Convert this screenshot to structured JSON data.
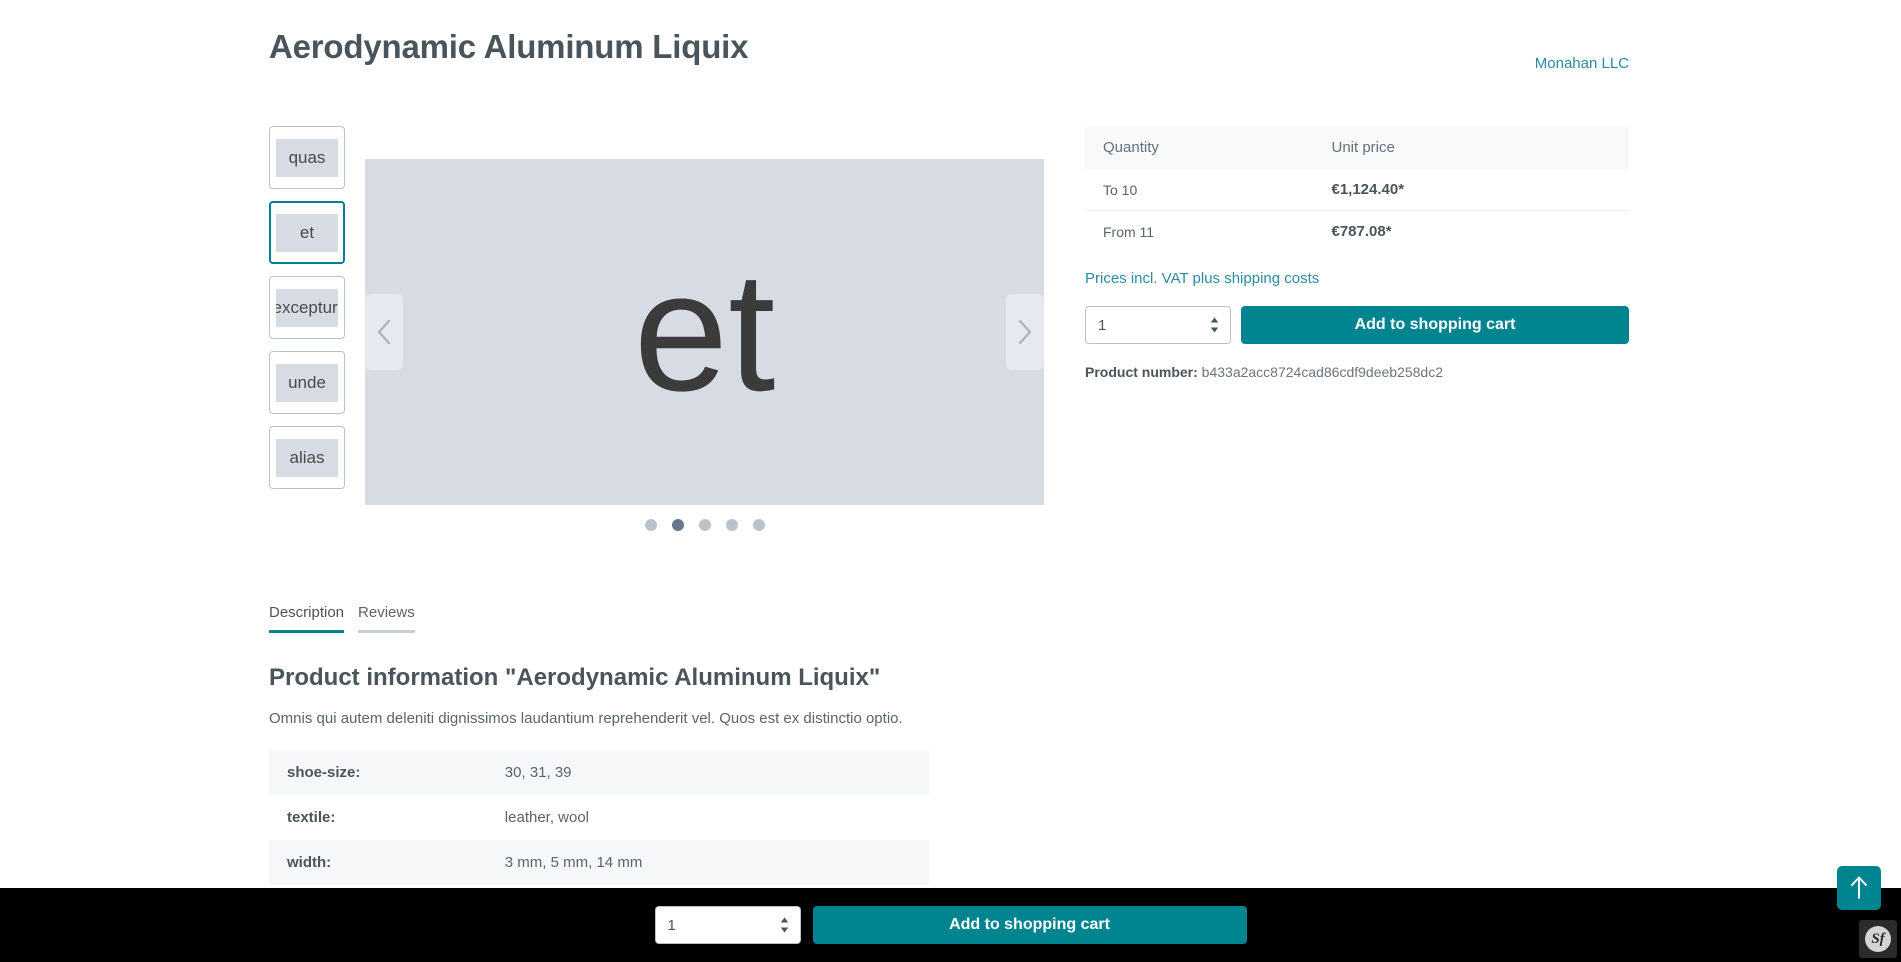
{
  "header": {
    "product_title": "Aerodynamic Aluminum Liquix",
    "manufacturer": "Monahan LLC"
  },
  "gallery": {
    "thumbnails": [
      {
        "label": "quas",
        "active": false
      },
      {
        "label": "et",
        "active": true
      },
      {
        "label": "excepturi",
        "active": false
      },
      {
        "label": "unde",
        "active": false
      },
      {
        "label": "alias",
        "active": false
      }
    ],
    "main_image_label": "et",
    "prev_icon": "chevron-left-icon",
    "next_icon": "chevron-right-icon",
    "dot_count": 5,
    "active_dot_index": 1
  },
  "buybox": {
    "table_headers": [
      "Quantity",
      "Unit price"
    ],
    "tiers": [
      {
        "quantity": "To 10",
        "price": "€1,124.40*"
      },
      {
        "quantity": "From 11",
        "price": "€787.08*"
      }
    ],
    "vat_note": "Prices incl. VAT plus shipping costs",
    "quantity_value": "1",
    "add_to_cart_label": "Add to shopping cart",
    "product_number_label": "Product number:",
    "product_number_value": "b433a2acc8724cad86cdf9deeb258dc2"
  },
  "tabs": [
    {
      "label": "Description",
      "active": true
    },
    {
      "label": "Reviews",
      "active": false
    }
  ],
  "description": {
    "heading": "Product information \"Aerodynamic Aluminum Liquix\"",
    "text": "Omnis qui autem deleniti dignissimos laudantium reprehenderit vel. Quos est ex distinctio optio.",
    "properties": [
      {
        "label": "shoe-size:",
        "value": "30, 31, 39"
      },
      {
        "label": "textile:",
        "value": "leather, wool"
      },
      {
        "label": "width:",
        "value": "3 mm, 5 mm, 14 mm"
      }
    ]
  },
  "sticky_bar": {
    "quantity_value": "1",
    "add_to_cart_label": "Add to shopping cart"
  },
  "floating": {
    "scroll_top_icon": "arrow-up-icon",
    "symfony_badge_label": "Sf"
  },
  "colors": {
    "accent_teal": "#008490",
    "link_teal": "#2c8ba3",
    "text_dark": "#4a545b",
    "placeholder_bg": "#d7dbe4",
    "sticky_bar_bg": "#000000"
  }
}
